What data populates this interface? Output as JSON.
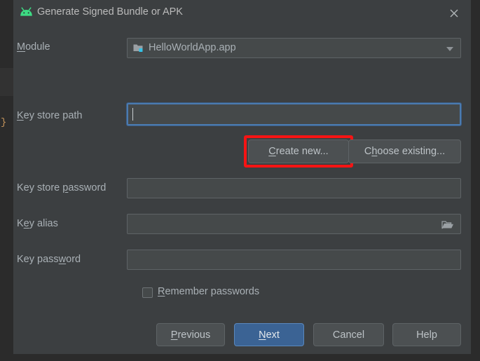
{
  "window": {
    "title": "Generate Signed Bundle or APK",
    "app_icon": "android-robot-icon",
    "close_icon": "close-icon"
  },
  "editor_backdrop": {
    "visible_code_fragment": "}"
  },
  "form": {
    "module": {
      "label": "Module",
      "mnemonic": "M",
      "value": "HelloWorldApp.app",
      "icon": "module-folder-icon",
      "dropdown_icon": "chevron-down-icon"
    },
    "key_store_path": {
      "label": "Key store path",
      "mnemonic": "K",
      "value": "",
      "placeholder": "",
      "focused": true
    },
    "key_store_password": {
      "label": "Key store password",
      "mnemonic": "p",
      "value": "",
      "placeholder": ""
    },
    "key_alias": {
      "label": "Key alias",
      "mnemonic": "e",
      "value": "",
      "placeholder": "",
      "browse_icon": "folder-open-icon"
    },
    "key_password": {
      "label": "Key password",
      "mnemonic": "w",
      "value": "",
      "placeholder": ""
    },
    "remember_passwords": {
      "label": "Remember passwords",
      "mnemonic": "R",
      "checked": false
    }
  },
  "keystore_actions": {
    "create_new": {
      "label": "Create new...",
      "mnemonic": "C",
      "highlighted": true,
      "highlight_color": "#f61414"
    },
    "choose_existing": {
      "label": "Choose existing...",
      "mnemonic": "h"
    }
  },
  "footer_buttons": [
    {
      "label": "Previous",
      "mnemonic": "P",
      "primary": false
    },
    {
      "label": "Next",
      "mnemonic": "N",
      "primary": true
    },
    {
      "label": "Cancel",
      "mnemonic": "",
      "primary": false
    },
    {
      "label": "Help",
      "mnemonic": "",
      "primary": false
    }
  ],
  "colors": {
    "dialog_background": "#3c3f41",
    "ide_background": "#2b2b2b",
    "field_background": "#45494a",
    "focus_border": "#4b7bb0",
    "primary_button": "#3b6394",
    "text": "#a9b0b5",
    "android_green": "#3ddc84",
    "annotation_red": "#f61414"
  }
}
